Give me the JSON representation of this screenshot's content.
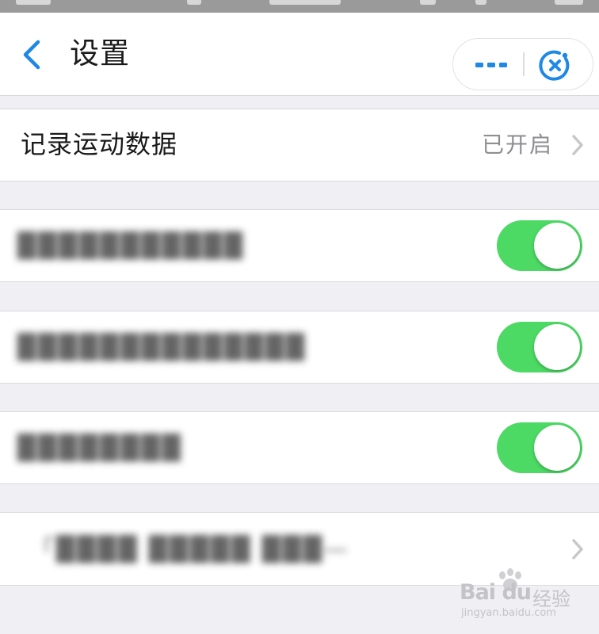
{
  "nav": {
    "title": "设置",
    "back_icon": "chevron-left-icon",
    "more_icon": "more-dots-icon",
    "close_icon": "mini-program-close-icon",
    "accent_color": "#1e88e5"
  },
  "settings": {
    "record_sport": {
      "label": "记录运动数据",
      "value": "已开启"
    },
    "toggles": [
      {
        "label": "███████████",
        "on": true
      },
      {
        "label": "██████████████",
        "on": true
      },
      {
        "label": "████████",
        "on": true
      }
    ],
    "last_item": {
      "label": "「████ █████ ███—",
      "has_chevron": true
    }
  },
  "toggle_on_color": "#4cd964",
  "watermark": {
    "brand": "Bai du",
    "cn": "经验",
    "url": "jingyan.baidu.com"
  }
}
